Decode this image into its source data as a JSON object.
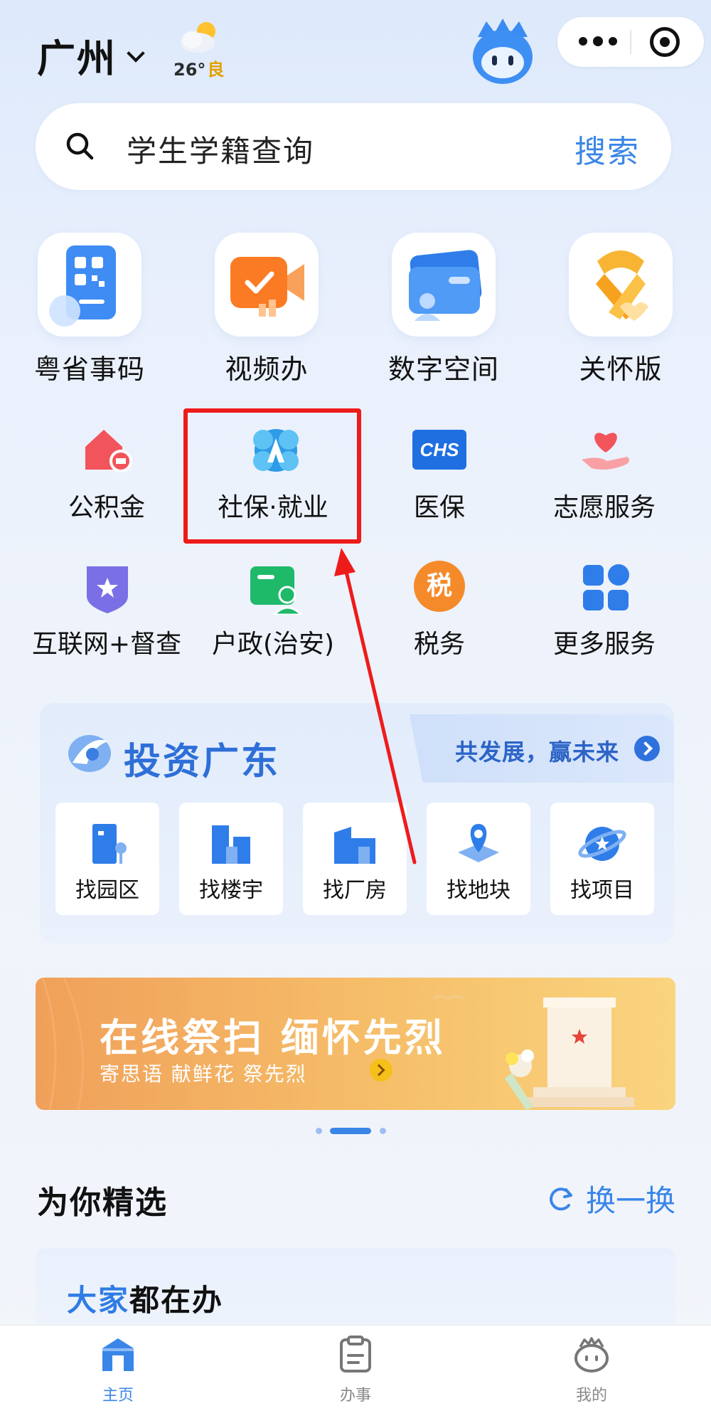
{
  "header": {
    "city": "广州",
    "temperature": "26°",
    "air_quality": "良"
  },
  "search": {
    "placeholder": "学生学籍查询",
    "button": "搜索"
  },
  "main_services": [
    {
      "label": "粤省事码",
      "icon": "qr-code-icon"
    },
    {
      "label": "视频办",
      "icon": "video-check-icon"
    },
    {
      "label": "数字空间",
      "icon": "wallet-user-icon"
    },
    {
      "label": "关怀版",
      "icon": "care-ribbon-icon"
    }
  ],
  "services": [
    {
      "label": "公积金",
      "icon": "house-fund-icon"
    },
    {
      "label": "社保·就业",
      "icon": "social-security-icon"
    },
    {
      "label": "医保",
      "icon": "chs-icon",
      "icon_text": "CHS"
    },
    {
      "label": "志愿服务",
      "icon": "heart-hand-icon"
    },
    {
      "label": "互联网+督查",
      "icon": "star-shield-icon"
    },
    {
      "label": "户政(治安)",
      "icon": "id-card-person-icon"
    },
    {
      "label": "税务",
      "icon": "tax-icon",
      "icon_text": "税"
    },
    {
      "label": "更多服务",
      "icon": "grid-icon"
    }
  ],
  "invest": {
    "title": "投资广东",
    "slogan": "共发展，赢未来",
    "options": [
      {
        "label": "找园区",
        "icon": "park-building-icon"
      },
      {
        "label": "找楼宇",
        "icon": "tower-icon"
      },
      {
        "label": "找厂房",
        "icon": "factory-icon"
      },
      {
        "label": "找地块",
        "icon": "map-pin-icon"
      },
      {
        "label": "找项目",
        "icon": "project-icon"
      }
    ]
  },
  "banner": {
    "title": "在线祭扫 缅怀先烈",
    "subtitle": "寄思语 献鲜花 祭先烈"
  },
  "recommend": {
    "title": "为你精选",
    "refresh": "换一换",
    "card_title_blue": "大家",
    "card_title_rest": "都在办"
  },
  "nav": {
    "home": "主页",
    "tasks": "办事",
    "mine": "我的"
  },
  "colors": {
    "accent": "#3a86e8",
    "highlight": "#ee1b1b"
  }
}
